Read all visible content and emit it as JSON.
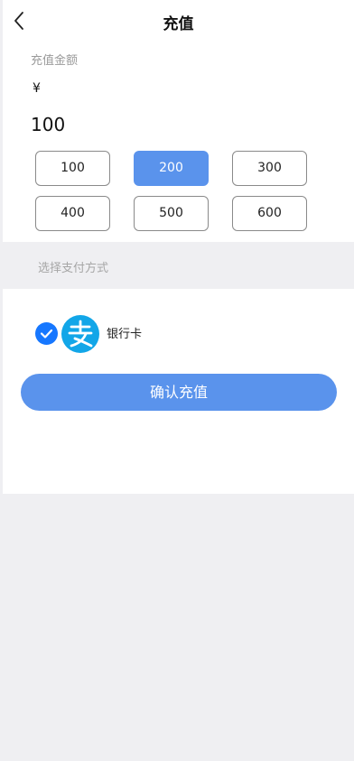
{
  "header": {
    "title": "充值",
    "back_icon": "chevron-left-icon"
  },
  "amount": {
    "label": "充值金额",
    "currency_symbol": "¥",
    "value": "100"
  },
  "presets": [
    {
      "label": "100",
      "selected": false
    },
    {
      "label": "200",
      "selected": true
    },
    {
      "label": "300",
      "selected": false
    },
    {
      "label": "400",
      "selected": false
    },
    {
      "label": "500",
      "selected": false
    },
    {
      "label": "600",
      "selected": false
    }
  ],
  "payment": {
    "section_title": "选择支付方式",
    "methods": [
      {
        "name": "银行卡",
        "icon": "alipay-icon",
        "checked": true
      }
    ]
  },
  "confirm_button": {
    "label": "确认充值"
  },
  "colors": {
    "accent": "#5a93ec",
    "check": "#1677ff",
    "alipay": "#12a6e8",
    "background": "#efeff2"
  }
}
